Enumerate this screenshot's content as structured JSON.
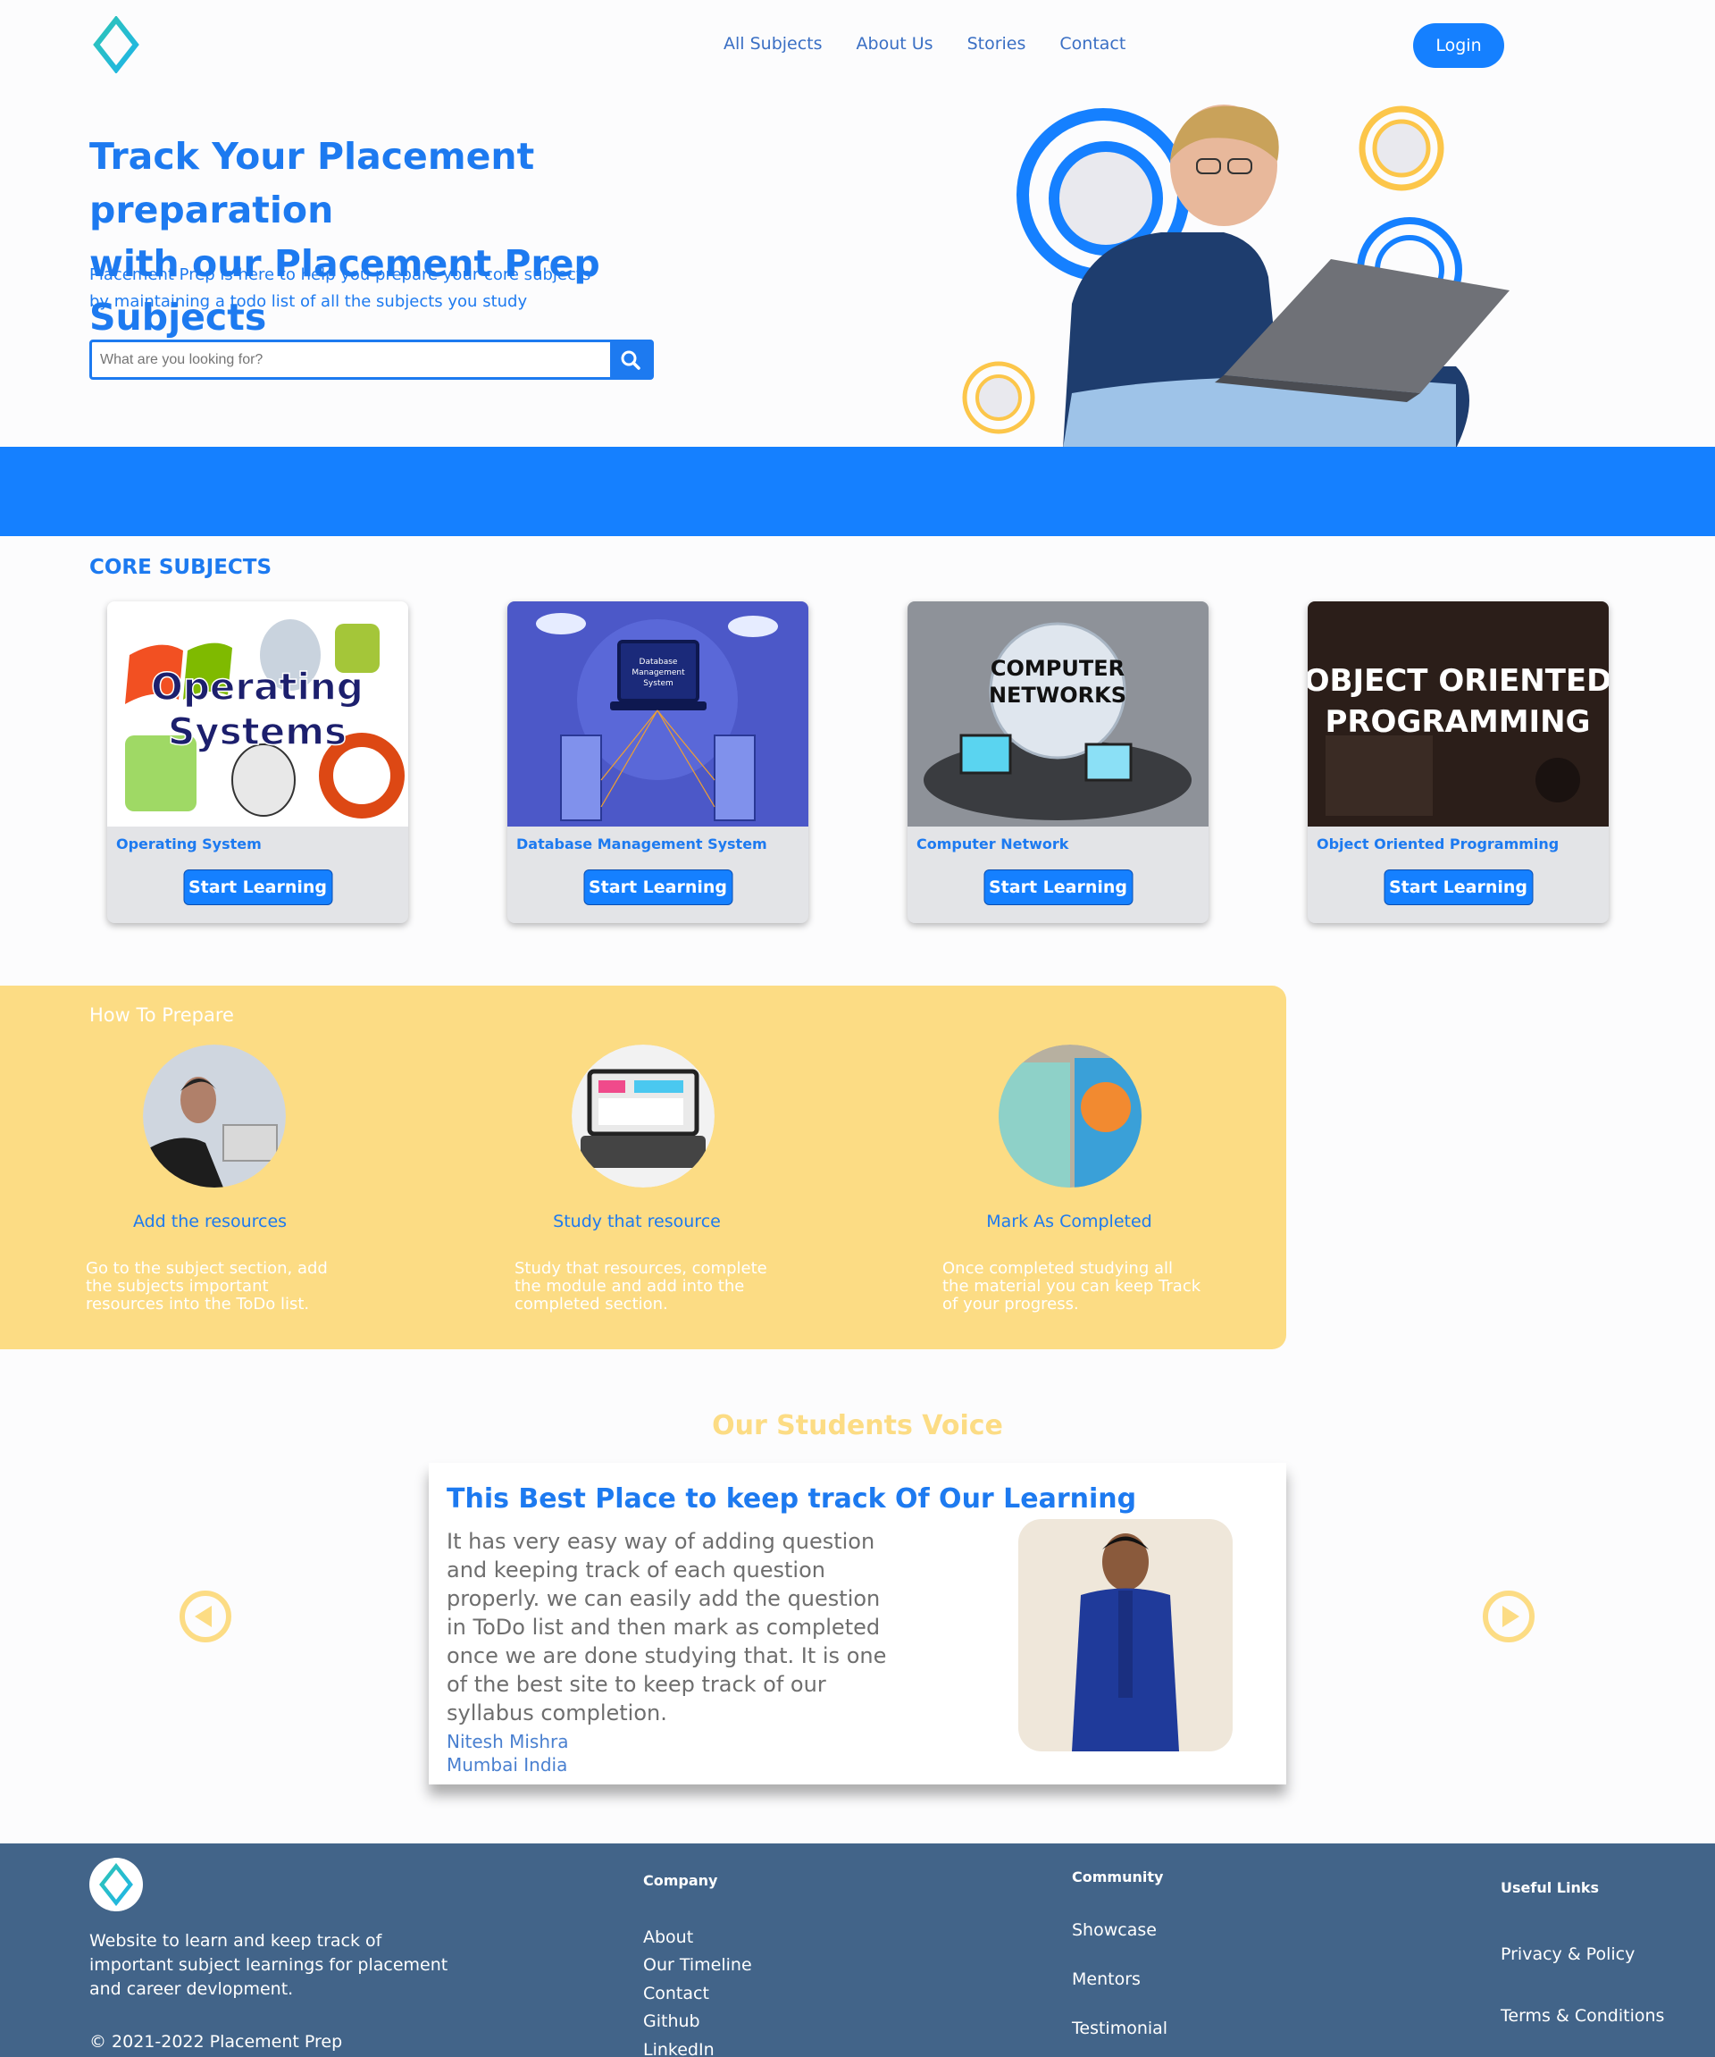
{
  "nav": {
    "links": [
      "All Subjects",
      "About Us",
      "Stories",
      "Contact"
    ],
    "login_label": "Login"
  },
  "hero": {
    "title_line1": "Track Your Placement preparation",
    "title_line2": "with our Placement Prep Subjects",
    "desc_line1": "Placement Prep is here to help you prepare your core subjects",
    "desc_line2": "by maintaining a todo list of all the subjects you study",
    "search_placeholder": "What are you looking for?"
  },
  "core": {
    "title": "CORE SUBJECTS",
    "cards": [
      {
        "title": "Operating System",
        "button": "Start Learning",
        "image_text_1": "Operating",
        "image_text_2": "Systems"
      },
      {
        "title": "Database Management System",
        "button": "Start Learning",
        "image_text_1": "Database",
        "image_text_2": "Management",
        "image_text_3": "System"
      },
      {
        "title": "Computer Network",
        "button": "Start Learning",
        "image_text_1": "COMPUTER",
        "image_text_2": "NETWORKS"
      },
      {
        "title": "Object Oriented Programming",
        "button": "Start Learning",
        "image_text_1": "OBJECT ORIENTED",
        "image_text_2": "PROGRAMMING"
      }
    ]
  },
  "prepare": {
    "title": "How To Prepare",
    "steps": [
      {
        "title": "Add the resources",
        "desc_lines": [
          "Go to the subject section, add",
          "the subjects important",
          "resources into the ToDo list."
        ]
      },
      {
        "title": "Study that resource",
        "desc_lines": [
          "Study that resources, complete",
          "the module and add into the",
          "completed section."
        ]
      },
      {
        "title": "Mark As Completed",
        "desc_lines": [
          "Once completed studying all",
          "the material you can keep Track",
          "of your progress."
        ]
      }
    ]
  },
  "voice": {
    "title": "Our Students Voice",
    "heading": "This Best Place to keep track Of Our Learning",
    "body": "It has very easy way of adding question and keeping track of each question properly. we can easily add the question in ToDo list and then mark as completed once we are done studying that. It is one of the best site to keep track of our syllabus completion.",
    "name": "Nitesh Mishra",
    "location": "Mumbai India"
  },
  "footer": {
    "desc": "Website to learn and keep track of important subject learnings for placement and career devlopment.",
    "copyright": "© 2021-2022 Placement Prep",
    "company": {
      "heading": "Company",
      "links": [
        "About",
        "Our Timeline",
        "Contact",
        "Github",
        "LinkedIn"
      ]
    },
    "community": {
      "heading": "Community",
      "links": [
        "Showcase",
        "Mentors",
        "Testimonial"
      ]
    },
    "useful": {
      "heading": "Useful Links",
      "links": [
        "Privacy & Policy",
        "Terms & Conditions"
      ]
    }
  },
  "colors": {
    "primary": "#1580ff",
    "accent_yellow": "#fcdc84",
    "footer_bg": "#426489",
    "logo_teal": "#2ec4b6"
  },
  "icons": [
    "diamond-logo-icon",
    "search-icon",
    "arrow-left-icon",
    "arrow-right-icon"
  ]
}
